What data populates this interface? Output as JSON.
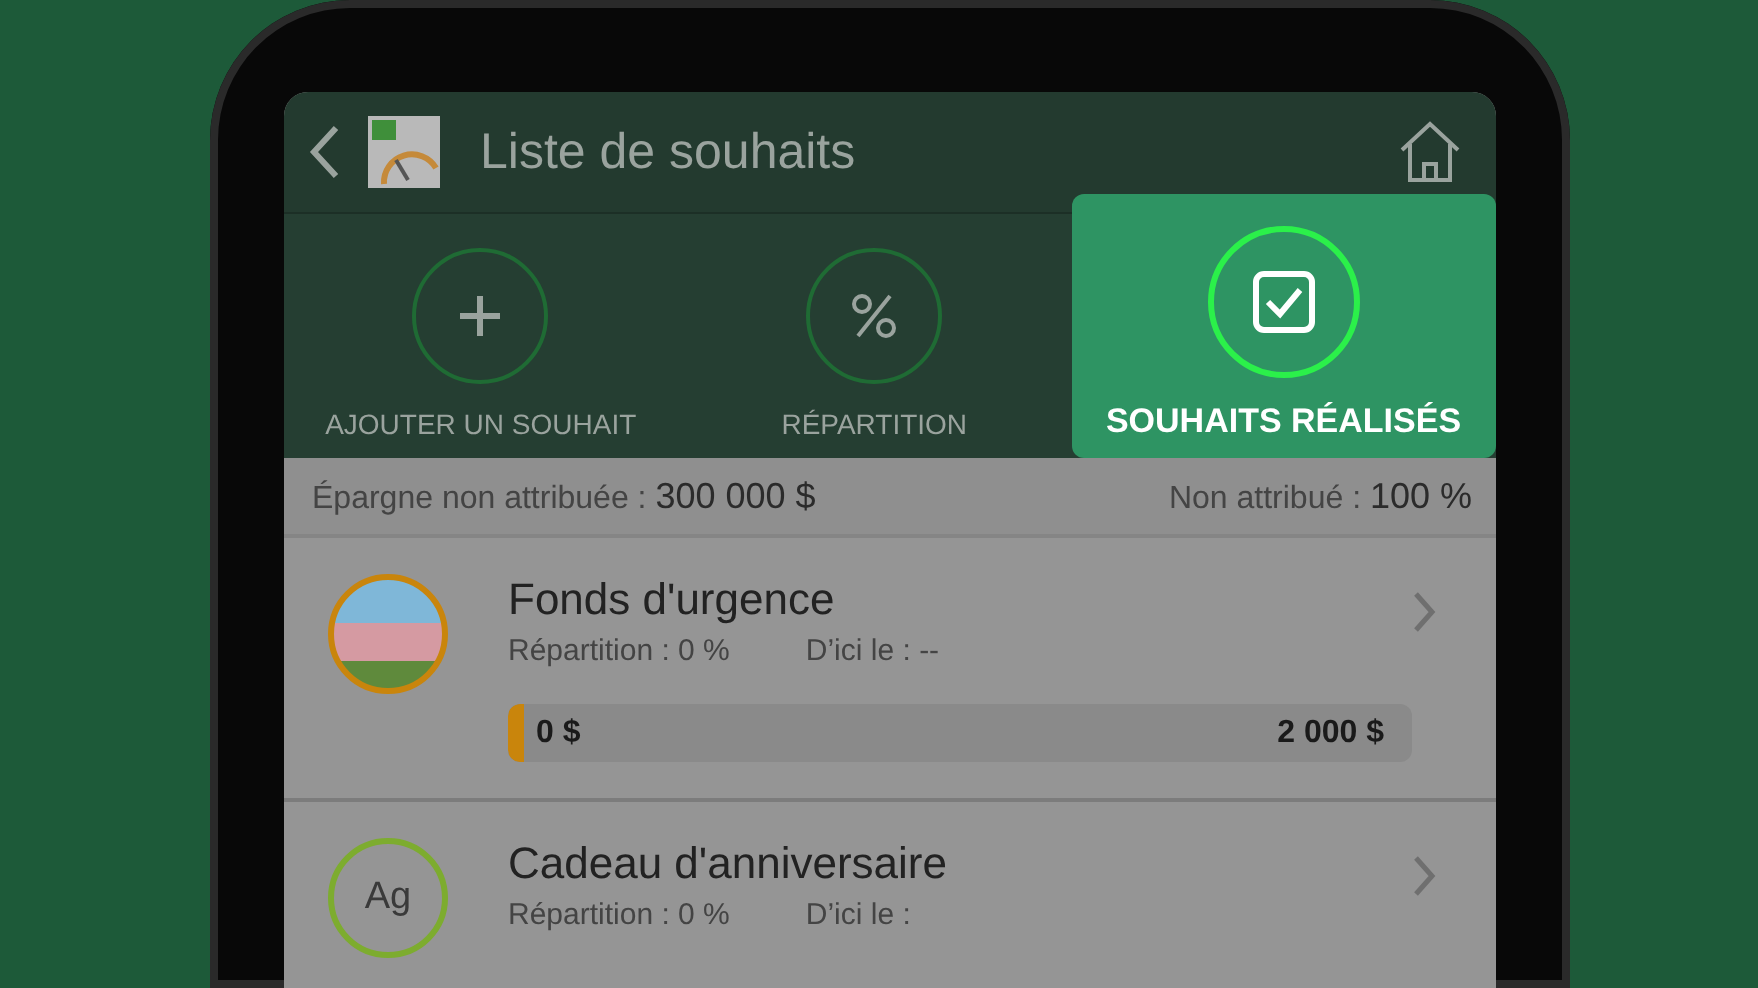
{
  "header": {
    "title": "Liste de souhaits"
  },
  "tabs": [
    {
      "label": "AJOUTER UN SOUHAIT",
      "kind": "add",
      "selected": false
    },
    {
      "label": "RÉPARTITION",
      "kind": "allocation",
      "selected": false
    },
    {
      "label": "SOUHAITS RÉALISÉS",
      "kind": "completed",
      "selected": true
    }
  ],
  "summary": {
    "left_label": "Épargne non attribuée :",
    "left_value": "300 000 $",
    "right_label": "Non attribué :",
    "right_value": "100 %"
  },
  "wishes": [
    {
      "name": "Fonds d'urgence",
      "avatar": {
        "kind": "photo"
      },
      "allocation": "Répartition : 0 %",
      "due": "D’ici le : --",
      "progress": {
        "saved": "0 $",
        "goal": "2 000 $",
        "level": 0.01
      }
    },
    {
      "name": "Cadeau d'anniversaire",
      "avatar": {
        "kind": "initials",
        "initials": "Ag"
      },
      "allocation": "Répartition : 0 %",
      "due": "D’ici le :"
    }
  ]
}
